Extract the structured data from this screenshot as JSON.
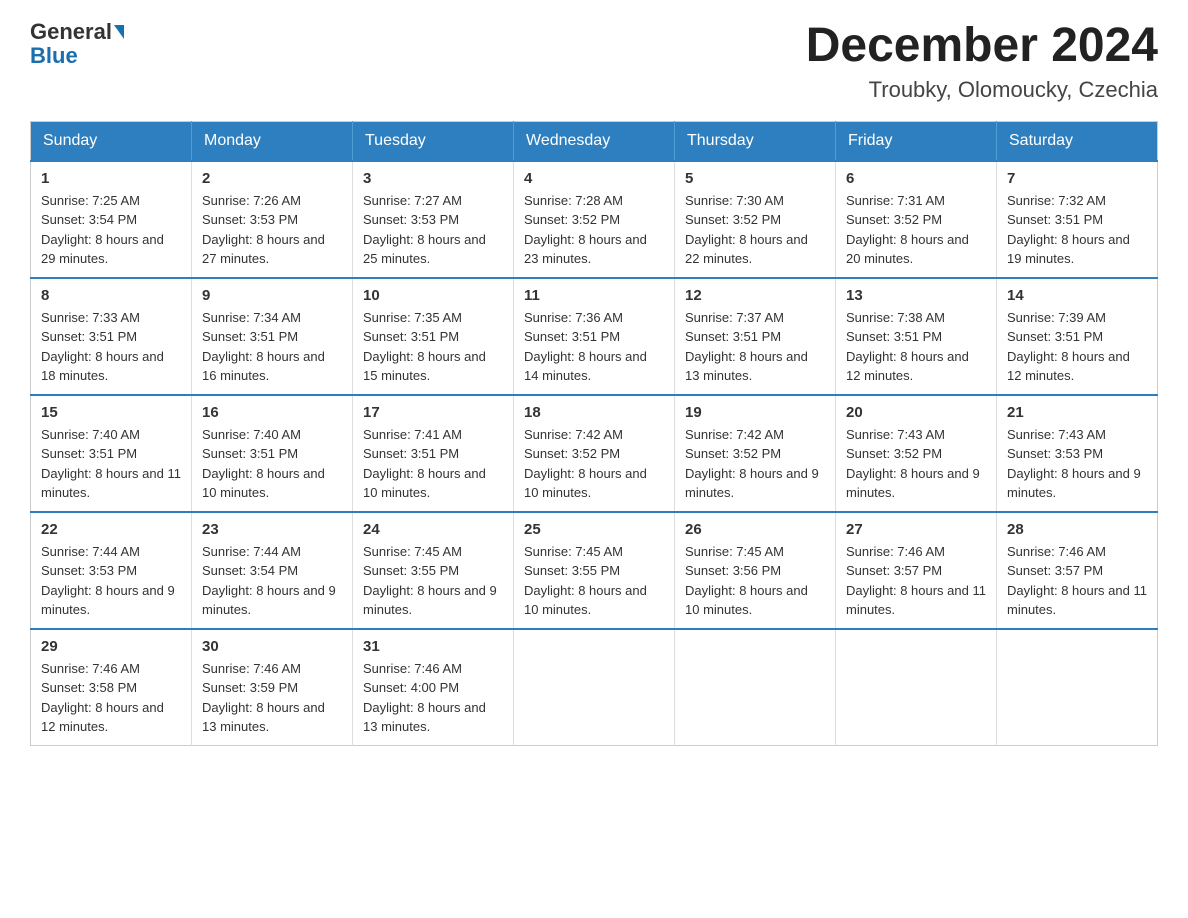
{
  "header": {
    "logo_general": "General",
    "logo_blue": "Blue",
    "month_title": "December 2024",
    "location": "Troubky, Olomoucky, Czechia"
  },
  "weekdays": [
    "Sunday",
    "Monday",
    "Tuesday",
    "Wednesday",
    "Thursday",
    "Friday",
    "Saturday"
  ],
  "weeks": [
    [
      {
        "day": "1",
        "sunrise": "7:25 AM",
        "sunset": "3:54 PM",
        "daylight": "8 hours and 29 minutes."
      },
      {
        "day": "2",
        "sunrise": "7:26 AM",
        "sunset": "3:53 PM",
        "daylight": "8 hours and 27 minutes."
      },
      {
        "day": "3",
        "sunrise": "7:27 AM",
        "sunset": "3:53 PM",
        "daylight": "8 hours and 25 minutes."
      },
      {
        "day": "4",
        "sunrise": "7:28 AM",
        "sunset": "3:52 PM",
        "daylight": "8 hours and 23 minutes."
      },
      {
        "day": "5",
        "sunrise": "7:30 AM",
        "sunset": "3:52 PM",
        "daylight": "8 hours and 22 minutes."
      },
      {
        "day": "6",
        "sunrise": "7:31 AM",
        "sunset": "3:52 PM",
        "daylight": "8 hours and 20 minutes."
      },
      {
        "day": "7",
        "sunrise": "7:32 AM",
        "sunset": "3:51 PM",
        "daylight": "8 hours and 19 minutes."
      }
    ],
    [
      {
        "day": "8",
        "sunrise": "7:33 AM",
        "sunset": "3:51 PM",
        "daylight": "8 hours and 18 minutes."
      },
      {
        "day": "9",
        "sunrise": "7:34 AM",
        "sunset": "3:51 PM",
        "daylight": "8 hours and 16 minutes."
      },
      {
        "day": "10",
        "sunrise": "7:35 AM",
        "sunset": "3:51 PM",
        "daylight": "8 hours and 15 minutes."
      },
      {
        "day": "11",
        "sunrise": "7:36 AM",
        "sunset": "3:51 PM",
        "daylight": "8 hours and 14 minutes."
      },
      {
        "day": "12",
        "sunrise": "7:37 AM",
        "sunset": "3:51 PM",
        "daylight": "8 hours and 13 minutes."
      },
      {
        "day": "13",
        "sunrise": "7:38 AM",
        "sunset": "3:51 PM",
        "daylight": "8 hours and 12 minutes."
      },
      {
        "day": "14",
        "sunrise": "7:39 AM",
        "sunset": "3:51 PM",
        "daylight": "8 hours and 12 minutes."
      }
    ],
    [
      {
        "day": "15",
        "sunrise": "7:40 AM",
        "sunset": "3:51 PM",
        "daylight": "8 hours and 11 minutes."
      },
      {
        "day": "16",
        "sunrise": "7:40 AM",
        "sunset": "3:51 PM",
        "daylight": "8 hours and 10 minutes."
      },
      {
        "day": "17",
        "sunrise": "7:41 AM",
        "sunset": "3:51 PM",
        "daylight": "8 hours and 10 minutes."
      },
      {
        "day": "18",
        "sunrise": "7:42 AM",
        "sunset": "3:52 PM",
        "daylight": "8 hours and 10 minutes."
      },
      {
        "day": "19",
        "sunrise": "7:42 AM",
        "sunset": "3:52 PM",
        "daylight": "8 hours and 9 minutes."
      },
      {
        "day": "20",
        "sunrise": "7:43 AM",
        "sunset": "3:52 PM",
        "daylight": "8 hours and 9 minutes."
      },
      {
        "day": "21",
        "sunrise": "7:43 AM",
        "sunset": "3:53 PM",
        "daylight": "8 hours and 9 minutes."
      }
    ],
    [
      {
        "day": "22",
        "sunrise": "7:44 AM",
        "sunset": "3:53 PM",
        "daylight": "8 hours and 9 minutes."
      },
      {
        "day": "23",
        "sunrise": "7:44 AM",
        "sunset": "3:54 PM",
        "daylight": "8 hours and 9 minutes."
      },
      {
        "day": "24",
        "sunrise": "7:45 AM",
        "sunset": "3:55 PM",
        "daylight": "8 hours and 9 minutes."
      },
      {
        "day": "25",
        "sunrise": "7:45 AM",
        "sunset": "3:55 PM",
        "daylight": "8 hours and 10 minutes."
      },
      {
        "day": "26",
        "sunrise": "7:45 AM",
        "sunset": "3:56 PM",
        "daylight": "8 hours and 10 minutes."
      },
      {
        "day": "27",
        "sunrise": "7:46 AM",
        "sunset": "3:57 PM",
        "daylight": "8 hours and 11 minutes."
      },
      {
        "day": "28",
        "sunrise": "7:46 AM",
        "sunset": "3:57 PM",
        "daylight": "8 hours and 11 minutes."
      }
    ],
    [
      {
        "day": "29",
        "sunrise": "7:46 AM",
        "sunset": "3:58 PM",
        "daylight": "8 hours and 12 minutes."
      },
      {
        "day": "30",
        "sunrise": "7:46 AM",
        "sunset": "3:59 PM",
        "daylight": "8 hours and 13 minutes."
      },
      {
        "day": "31",
        "sunrise": "7:46 AM",
        "sunset": "4:00 PM",
        "daylight": "8 hours and 13 minutes."
      },
      null,
      null,
      null,
      null
    ]
  ]
}
